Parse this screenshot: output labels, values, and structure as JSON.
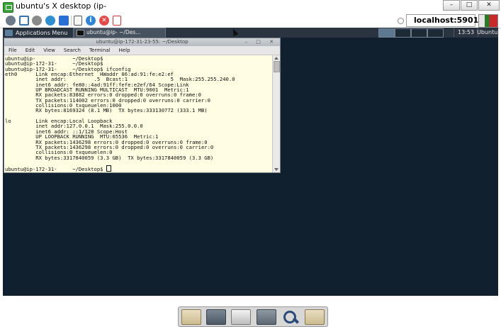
{
  "viewer": {
    "title": "ubuntu's X desktop (ip-",
    "window_buttons": [
      "–",
      "□",
      "✕"
    ],
    "toolbar_icons": [
      "connection-options-icon",
      "fullscreen-icon",
      "settings-icon",
      "refresh-icon",
      "send-ctrl-alt-del-icon",
      "clipboard-icon",
      "info-icon",
      "disconnect-icon",
      "file-transfer-icon"
    ],
    "host": "localhost:5901"
  },
  "desktop": {
    "panel": {
      "applications_label": "Applications Menu",
      "task_label": "ubuntu@ip-            ~/Des...",
      "clock": "13:53",
      "user": "Ubuntu"
    },
    "terminal": {
      "title": "ubuntu@ip-172-31-23-55: ~/Desktop",
      "menu": [
        "File",
        "Edit",
        "View",
        "Search",
        "Terminal",
        "Help"
      ],
      "lines": [
        "ubuntu@ip-            ~/Desktop$",
        "ubuntu@ip-172-31-     ~/Desktop$",
        "ubuntu@ip-172-31-     ~/Desktop$ ifconfig",
        "eth0      Link encap:Ethernet  HWaddr 06:ad:91:fe:e2:ef",
        "          inet addr:         .5  Bcast:1              5  Mask:255.255.240.0",
        "          inet6 addr: fe80::4ad:91ff:fefe:e2ef/64 Scope:Link",
        "          UP BROADCAST RUNNING MULTICAST  MTU:9001  Metric:1",
        "          RX packets:83882 errors:0 dropped:0 overruns:0 frame:0",
        "          TX packets:114002 errors:0 dropped:0 overruns:0 carrier:0",
        "          collisions:0 txqueuelen:1000",
        "          RX bytes:8169324 (8.1 MB)  TX bytes:333130772 (333.1 MB)",
        "",
        "lo        Link encap:Local Loopback",
        "          inet addr:127.0.0.1  Mask:255.0.0.0",
        "          inet6 addr: ::1/128 Scope:Host",
        "          UP LOOPBACK RUNNING  MTU:65536  Metric:1",
        "          RX packets:1436298 errors:0 dropped:0 overruns:0 frame:0",
        "          TX packets:1436298 errors:0 dropped:0 overruns:0 carrier:0",
        "          collisions:0 txqueuelen:0",
        "          RX bytes:3317840059 (3.3 GB)  TX bytes:3317840059 (3.3 GB)",
        "",
        "ubuntu@ip-172-31-     ~/Desktop$ "
      ]
    },
    "dock_items": [
      "home-folder-icon",
      "terminal-icon",
      "mail-icon",
      "drive-icon",
      "search-icon",
      "files-folder-icon"
    ]
  }
}
